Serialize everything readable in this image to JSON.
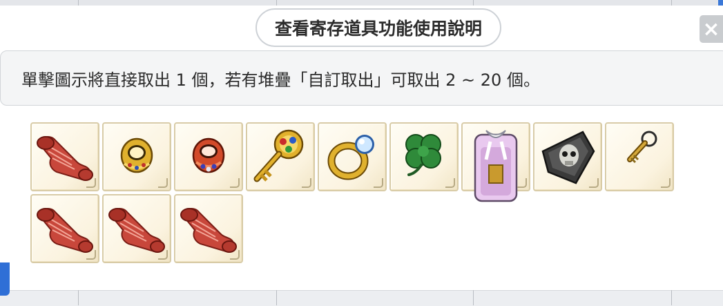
{
  "dialog": {
    "help_button_label": "查看寄存道具功能使用說明",
    "close_label": "×",
    "info_text": "單擊圖示將直接取出 1 個，若有堆疊「自訂取出」可取出 2 ~ 20 個。"
  },
  "items": [
    {
      "icon": "scroll-icon"
    },
    {
      "icon": "gold-ring-icon"
    },
    {
      "icon": "red-ring-icon"
    },
    {
      "icon": "jeweled-key-icon"
    },
    {
      "icon": "diamond-ring-icon"
    },
    {
      "icon": "clover-icon"
    },
    {
      "icon": "charm-tag-icon"
    },
    {
      "icon": "skull-shield-icon"
    },
    {
      "icon": "small-key-icon"
    },
    {
      "icon": "scroll-icon"
    },
    {
      "icon": "scroll-icon"
    },
    {
      "icon": "scroll-icon"
    }
  ],
  "colors": {
    "slot_bg": "#fbf3df",
    "slot_border": "#d8cba6",
    "info_bg": "#f4f5f6",
    "close_bg": "#c9cccf"
  }
}
